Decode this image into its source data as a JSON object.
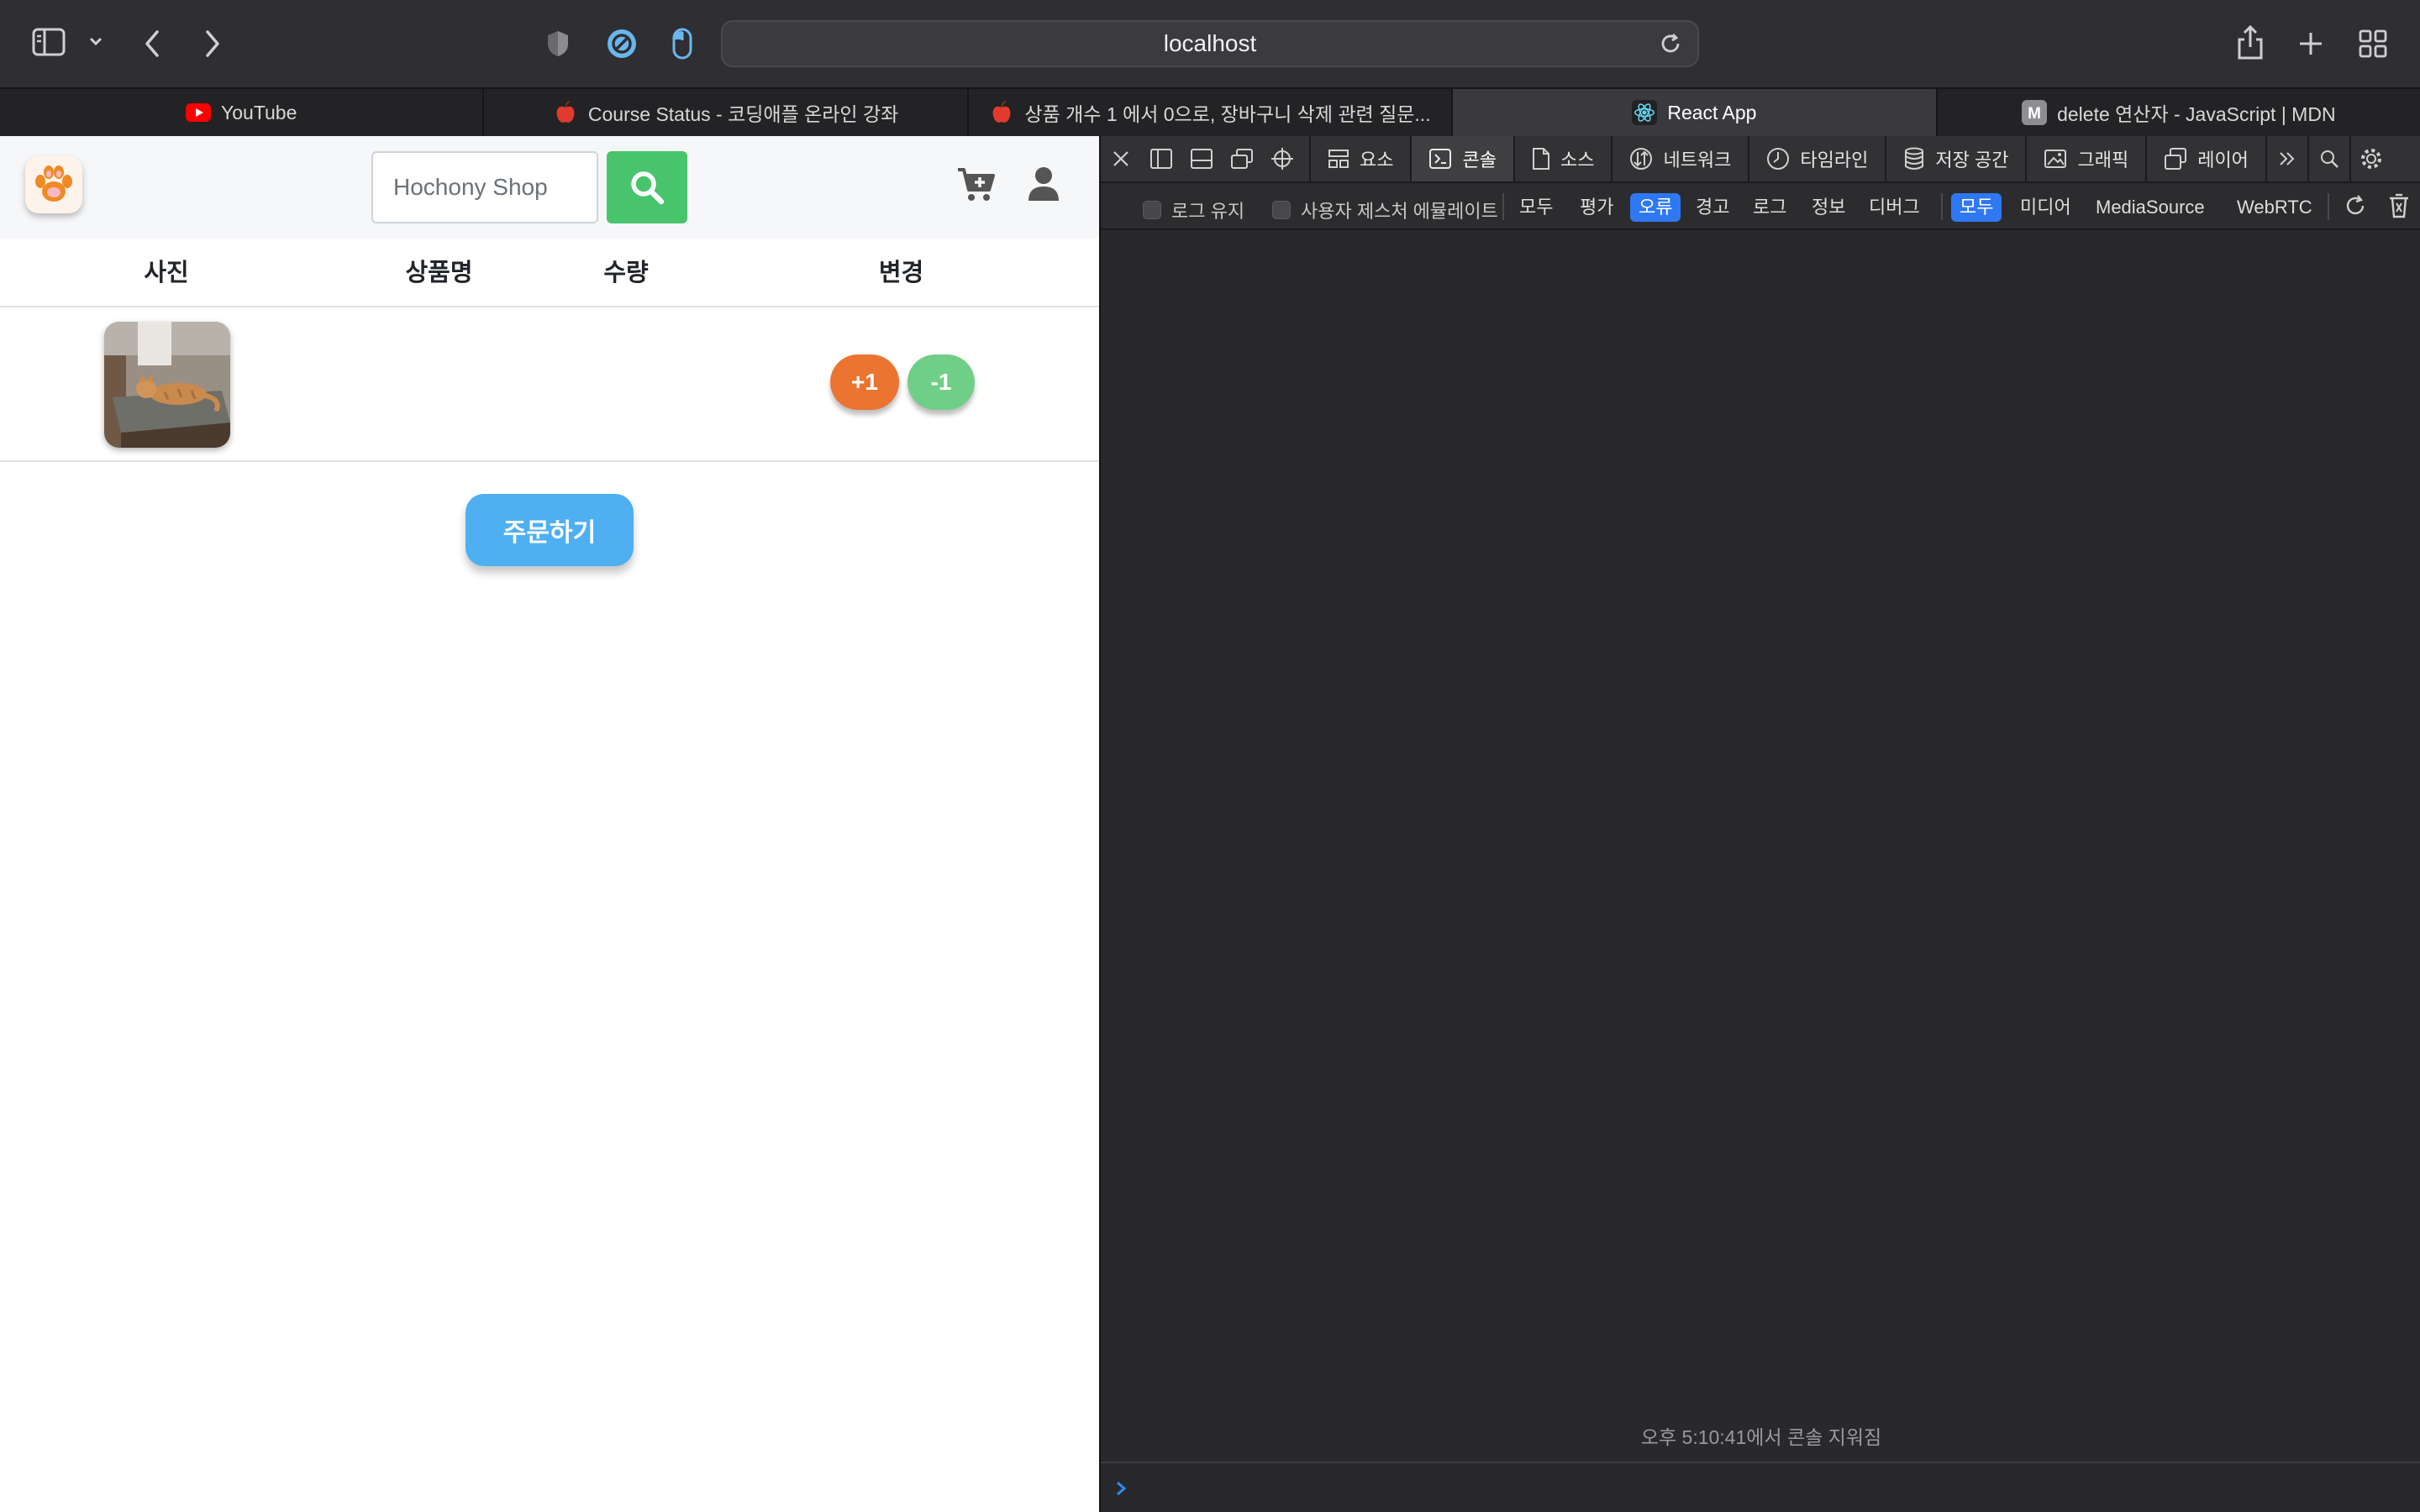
{
  "browser": {
    "address": "localhost",
    "tabs": [
      {
        "label": "YouTube",
        "icon": "youtube-icon",
        "active": false
      },
      {
        "label": "Course Status - 코딩애플 온라인 강좌",
        "icon": "apple-favicon",
        "active": false
      },
      {
        "label": "상품 개수 1 에서 0으로, 장바구니 삭제 관련 질문...",
        "icon": "apple-favicon",
        "active": false
      },
      {
        "label": "React App",
        "icon": "react-icon",
        "active": true
      },
      {
        "label": "delete 연산자 - JavaScript | MDN",
        "icon": "mdn-icon",
        "active": false
      }
    ]
  },
  "page": {
    "search": {
      "placeholder": "Hochony Shop",
      "value": ""
    },
    "table": {
      "headers": {
        "photo": "사진",
        "name": "상품명",
        "qty": "수량",
        "change": "변경"
      },
      "rows": [
        {
          "photo": "cat-photo",
          "name": "",
          "qty": "",
          "plus_label": "+1",
          "minus_label": "-1"
        }
      ]
    },
    "order_label": "주문하기",
    "colors": {
      "search_button": "#48c46c",
      "plus_button": "#eb7431",
      "minus_button": "#6fcf86",
      "order_button": "#4eb0f1"
    }
  },
  "devtools": {
    "tabs": [
      {
        "label": "요소",
        "icon": "elements-icon",
        "active": false
      },
      {
        "label": "콘솔",
        "icon": "console-icon",
        "active": true
      },
      {
        "label": "소스",
        "icon": "sources-icon",
        "active": false
      },
      {
        "label": "네트워크",
        "icon": "network-icon",
        "active": false
      },
      {
        "label": "타임라인",
        "icon": "timeline-icon",
        "active": false
      },
      {
        "label": "저장 공간",
        "icon": "storage-icon",
        "active": false
      },
      {
        "label": "그래픽",
        "icon": "graphics-icon",
        "active": false
      },
      {
        "label": "레이어",
        "icon": "layers-icon",
        "active": false
      }
    ],
    "filters": {
      "preserve_log": "로그 유지",
      "emulate_gesture": "사용자 제스처 에뮬레이트",
      "levels": [
        "모두",
        "평가",
        "오류",
        "경고",
        "로그",
        "정보",
        "디버그"
      ],
      "selected_level": "오류",
      "sources": [
        "모두",
        "미디어",
        "MediaSource",
        "WebRTC"
      ],
      "selected_source": "모두"
    },
    "console_message": "오후 5:10:41에서 콘솔 지워짐"
  }
}
